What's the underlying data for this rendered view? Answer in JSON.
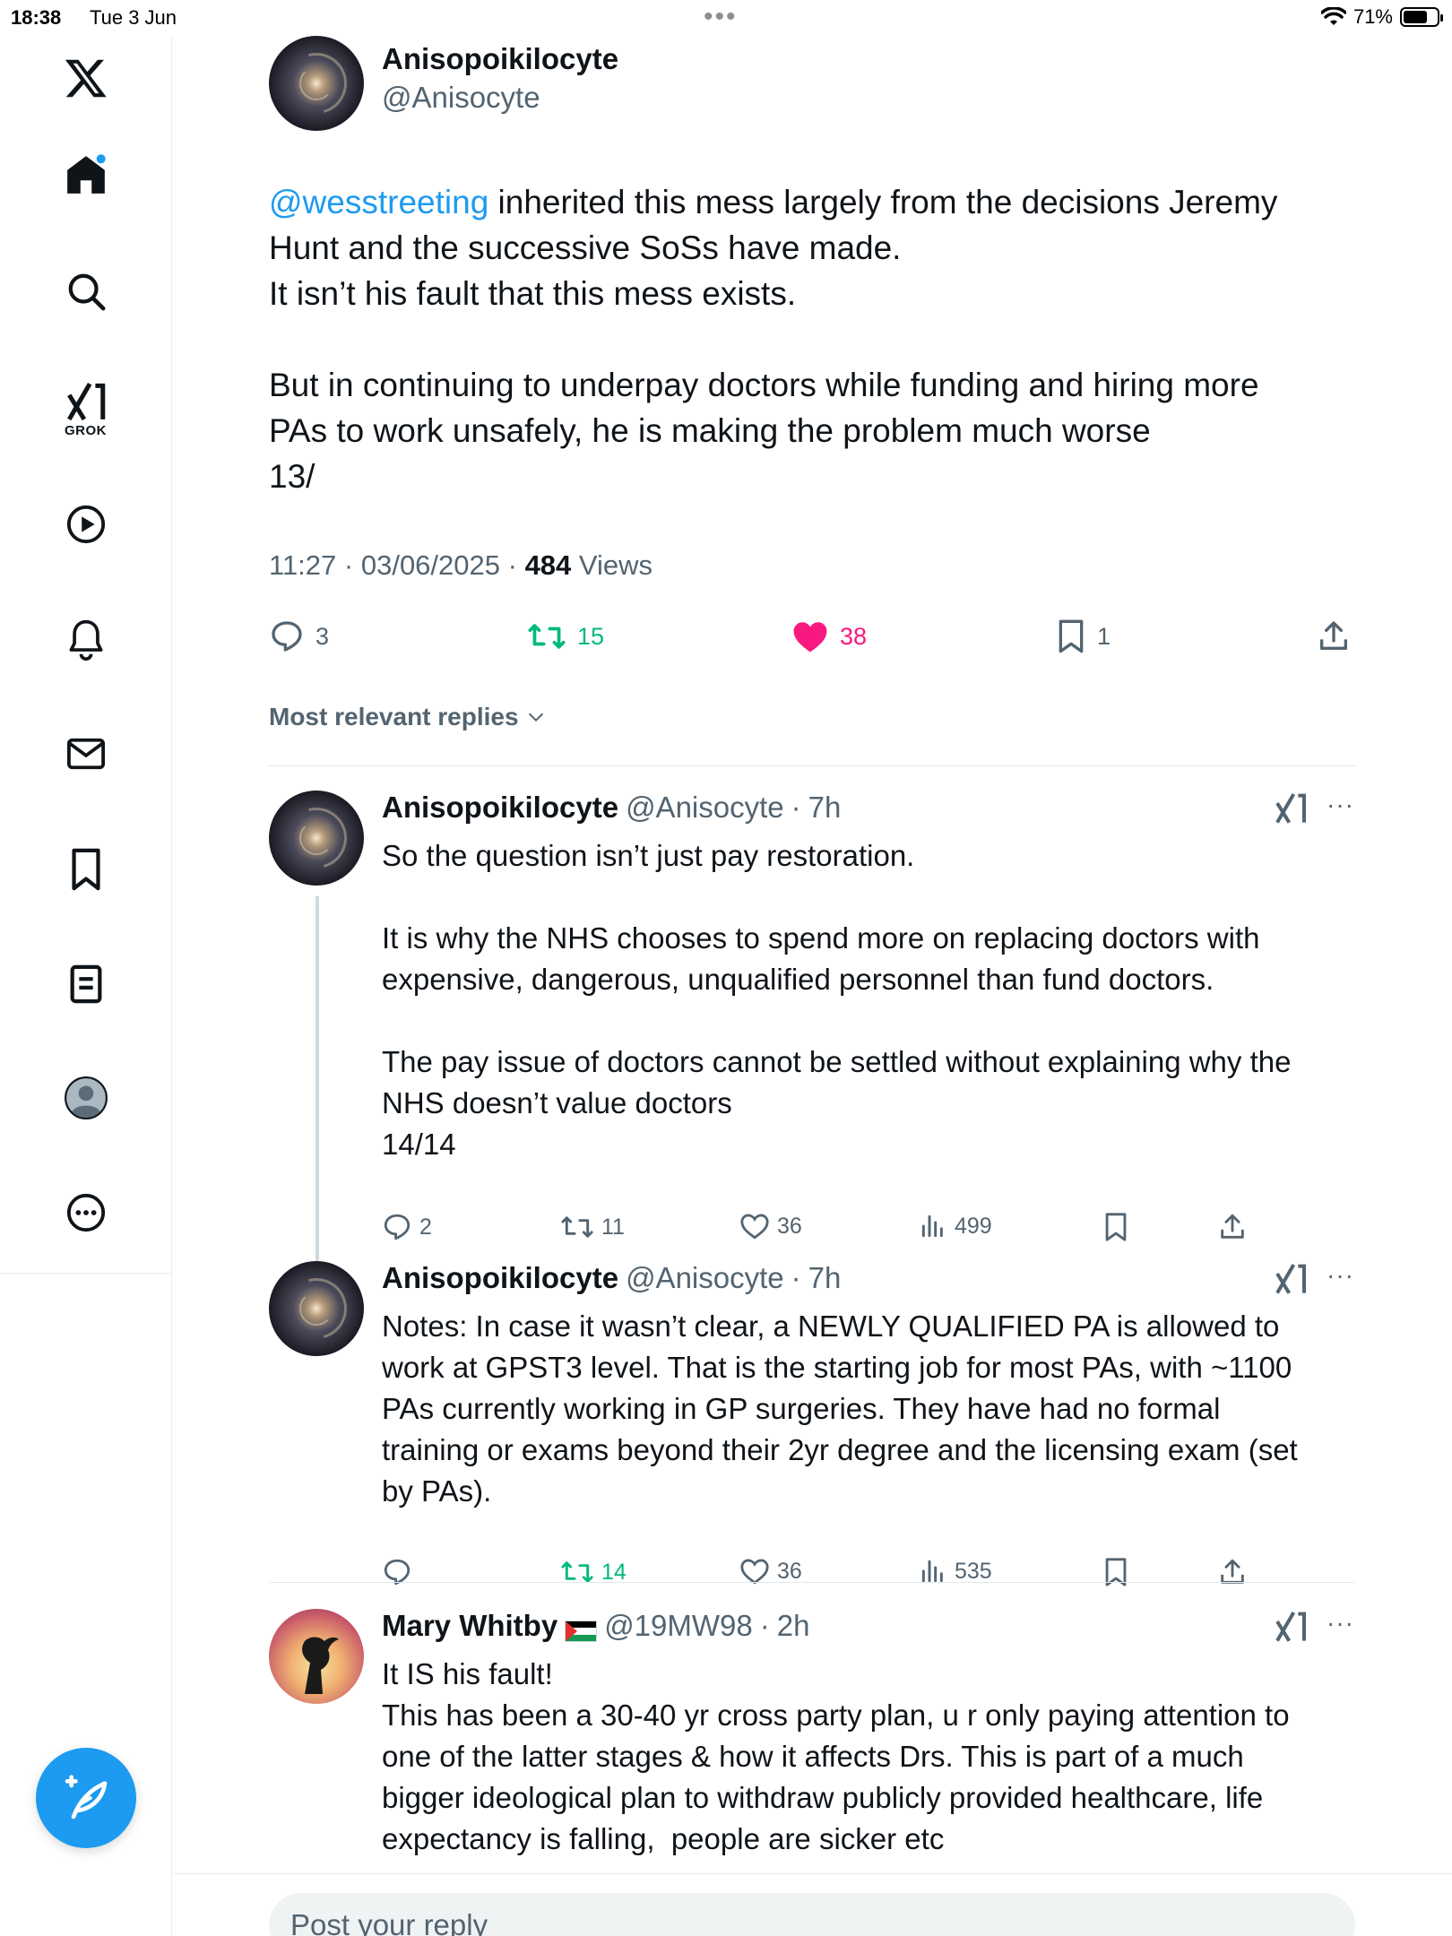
{
  "status_bar": {
    "time": "18:38",
    "date": "Tue 3 Jun",
    "battery": "71%",
    "battery_level": 0.71
  },
  "sidebar": {
    "items": [
      {
        "name": "x-logo-icon"
      },
      {
        "name": "home-icon"
      },
      {
        "name": "search-icon"
      },
      {
        "name": "grok-icon",
        "label": "GROK"
      },
      {
        "name": "video-icon"
      },
      {
        "name": "notifications-icon"
      },
      {
        "name": "messages-icon"
      },
      {
        "name": "bookmarks-icon"
      },
      {
        "name": "lists-icon"
      },
      {
        "name": "profile-icon"
      },
      {
        "name": "more-icon"
      }
    ]
  },
  "colors": {
    "accent": "#1d9bf0",
    "retweet": "#00ba7c",
    "like": "#f91880",
    "muted": "#536471"
  },
  "main_tweet": {
    "display_name": "Anisopoikilocyte",
    "handle": "@Anisocyte",
    "mention": "@wesstreeting",
    "text_after_mention": " inherited this mess largely from the decisions Jeremy\nHunt and the successive SoSs have made.\nIt isn’t his fault that this mess exists.\n\nBut in continuing to underpay doctors while funding and hiring more\nPAs to work unsafely, he is making the problem much worse\n13/",
    "time": "11:27",
    "date": "03/06/2025",
    "views_count": "484",
    "views_label": "Views",
    "replies": "3",
    "reposts": "15",
    "likes": "38",
    "bookmarks": "1"
  },
  "replies_filter": "Most relevant replies",
  "replies": [
    {
      "display_name": "Anisopoikilocyte",
      "handle": "@Anisocyte",
      "age": "7h",
      "text": "So the question isn’t just pay restoration.\n\nIt is why the NHS chooses to spend more on replacing doctors with\nexpensive, dangerous, unqualified personnel than fund doctors.\n\nThe pay issue of doctors cannot be settled without explaining why the\nNHS doesn’t value doctors\n14/14",
      "replies": "2",
      "reposts": "11",
      "likes": "36",
      "views": "499"
    },
    {
      "display_name": "Anisopoikilocyte",
      "handle": "@Anisocyte",
      "age": "7h",
      "text": "Notes: In case it wasn’t clear, a NEWLY QUALIFIED PA is allowed to\nwork at GPST3 level. That is the starting job for most PAs, with ~1100\nPAs currently working in GP surgeries. They have had no formal\ntraining or exams beyond their 2yr degree and the licensing exam (set\nby PAs).",
      "replies": "",
      "reposts": "14",
      "likes": "36",
      "views": "535"
    },
    {
      "display_name": "Mary Whitby",
      "handle": "@19MW98",
      "age": "2h",
      "text": "It IS his fault!\nThis has been a 30-40 yr cross party plan, u r only paying attention to\none of the latter stages & how it affects Drs. This is part of a much\nbigger ideological plan to withdraw publicly provided healthcare, life\nexpectancy is falling,  people are sicker etc"
    }
  ],
  "reply_placeholder": "Post your reply"
}
